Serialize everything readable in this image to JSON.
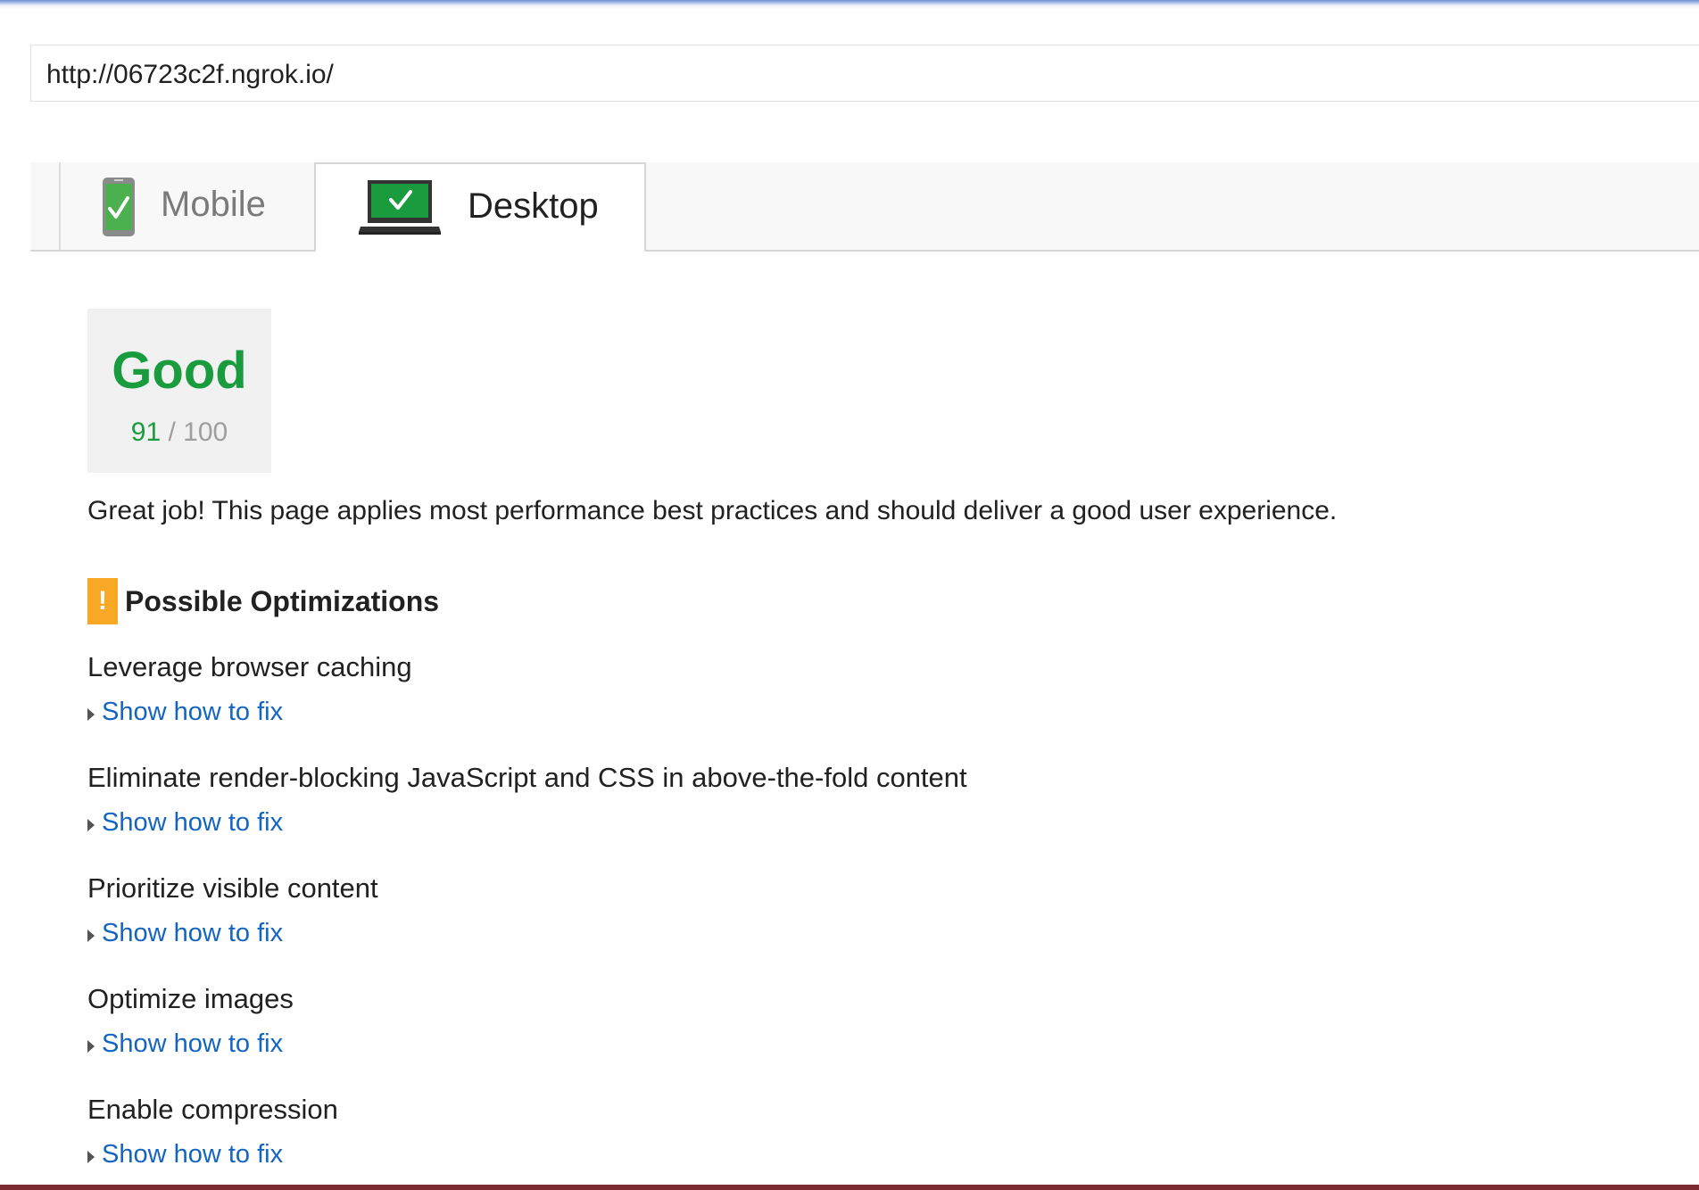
{
  "url": "http://06723c2f.ngrok.io/",
  "tabs": [
    {
      "label": "Mobile",
      "icon": "phone-check-icon",
      "active": false
    },
    {
      "label": "Desktop",
      "icon": "laptop-check-icon",
      "active": true
    }
  ],
  "score": {
    "label": "Good",
    "value": "91",
    "max": "/ 100",
    "color": "#1a9c3e"
  },
  "summary": "Great job! This page applies most performance best practices and should deliver a good user experience.",
  "optimizations": {
    "title": "Possible Optimizations",
    "icon": "warning-icon",
    "icon_glyph": "!",
    "icon_color": "#f9a825",
    "rules": [
      {
        "title": "Leverage browser caching",
        "link": "Show how to fix"
      },
      {
        "title": "Eliminate render-blocking JavaScript and CSS in above-the-fold content",
        "link": "Show how to fix"
      },
      {
        "title": "Prioritize visible content",
        "link": "Show how to fix"
      },
      {
        "title": "Optimize images",
        "link": "Show how to fix"
      },
      {
        "title": "Enable compression",
        "link": "Show how to fix"
      }
    ]
  },
  "colors": {
    "link": "#1565c0",
    "good": "#1a9c3e",
    "warning": "#f9a825"
  }
}
